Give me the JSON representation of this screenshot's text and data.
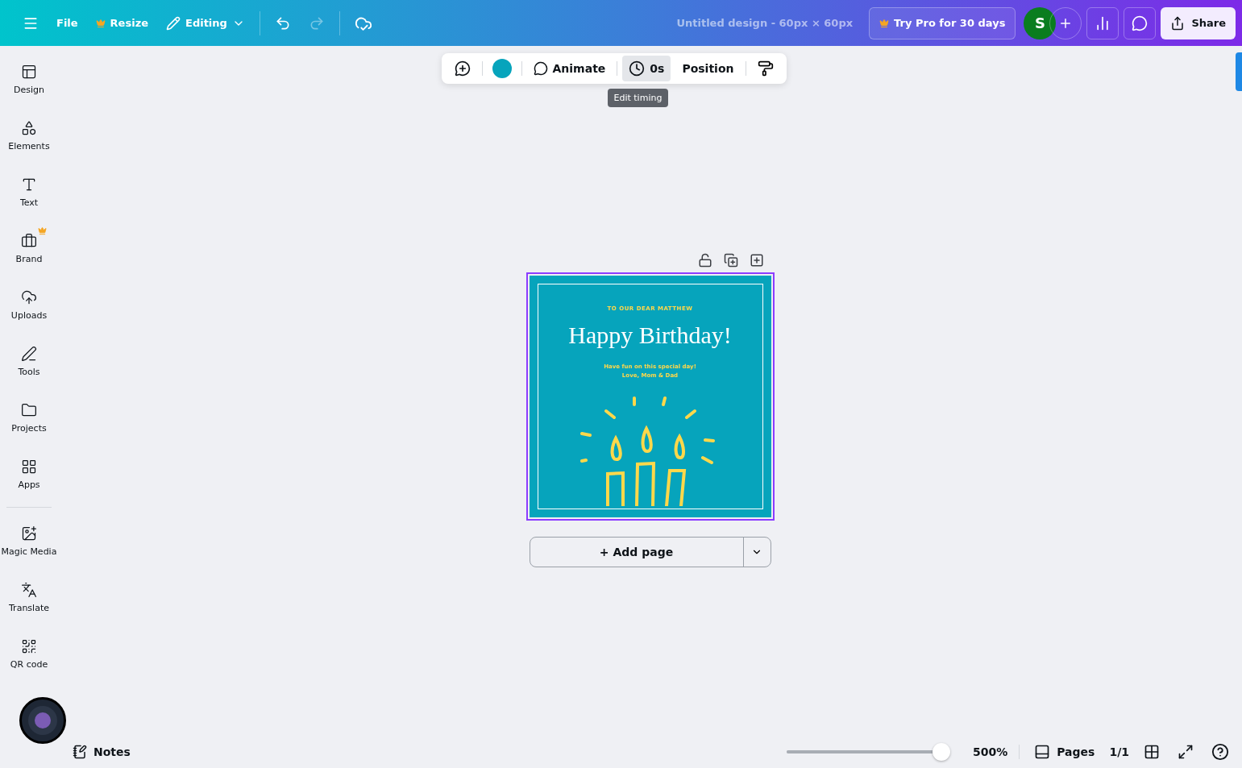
{
  "topbar": {
    "menu": [
      "File",
      "Resize"
    ],
    "mode": "Editing",
    "title": "Untitled design - 60px × 60px",
    "pro_button": "Try Pro for 30 days",
    "avatar": "S",
    "share": "Share",
    "redo_disabled": true
  },
  "toolbar": {
    "animate": "Animate",
    "timing": "0s",
    "position": "Position",
    "tooltip": "Edit timing"
  },
  "sidebar": {
    "items": [
      {
        "label": "Design",
        "kind": "design",
        "pro": false
      },
      {
        "label": "Elements",
        "kind": "elements",
        "pro": false
      },
      {
        "label": "Text",
        "kind": "text",
        "pro": false
      },
      {
        "label": "Brand",
        "kind": "brand",
        "pro": true
      },
      {
        "label": "Uploads",
        "kind": "uploads",
        "pro": false
      },
      {
        "label": "Tools",
        "kind": "tools",
        "pro": false
      },
      {
        "label": "Projects",
        "kind": "projects",
        "pro": false
      },
      {
        "label": "Apps",
        "kind": "apps",
        "pro": false
      }
    ],
    "extra": [
      {
        "label": "Magic Media",
        "kind": "magic",
        "pro": false
      },
      {
        "label": "Translate",
        "kind": "translate",
        "pro": false
      },
      {
        "label": "QR code",
        "kind": "qr",
        "pro": false
      }
    ]
  },
  "card": {
    "to": "TO OUR DEAR MATTHEW",
    "heading": "Happy Birthday!",
    "message": "Have fun on this special day!",
    "signature": "Love, Mom & Dad"
  },
  "add_page": "+ Add page",
  "footer": {
    "notes": "Notes",
    "zoom": {
      "level": 1
    },
    "zoom_reading": "500%",
    "pages": "Pages",
    "page_count": "1/1"
  }
}
